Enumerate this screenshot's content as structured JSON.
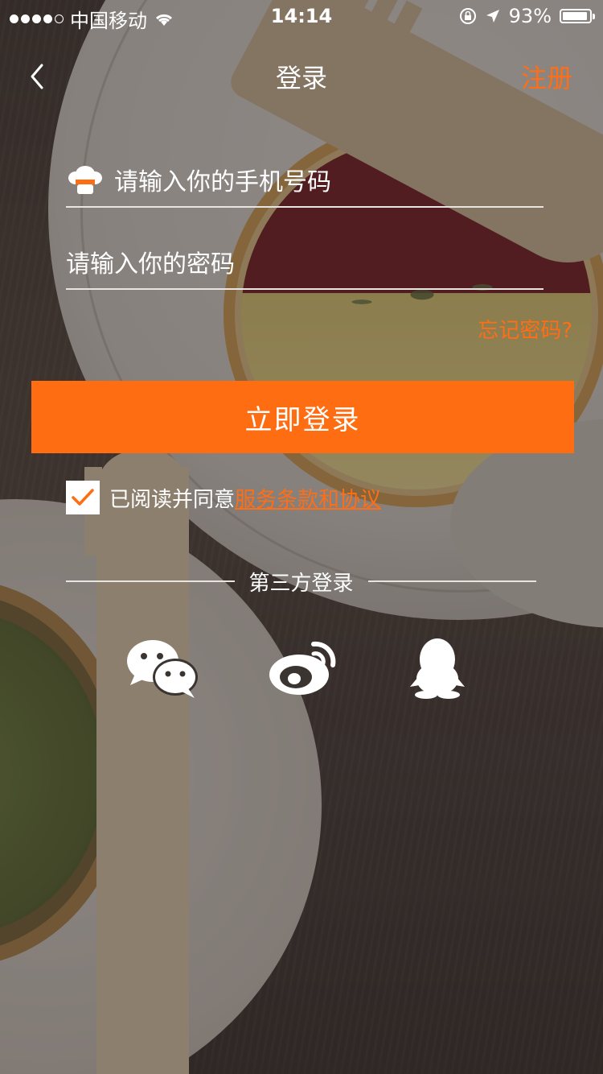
{
  "status_bar": {
    "carrier": "中国移动",
    "time": "14:14",
    "battery": "93%",
    "battery_level": 0.93,
    "signal_bars_filled": 4,
    "signal_bars_total": 5
  },
  "nav": {
    "title": "登录",
    "register": "注册",
    "back_icon": "chevron-left-icon"
  },
  "form": {
    "phone_placeholder": "请输入你的手机号码",
    "password_placeholder": "请输入你的密码",
    "forgot": "忘记密码?",
    "phone_icon": "chef-hat-icon"
  },
  "login_button": "立即登录",
  "agreement": {
    "checked": true,
    "text": "已阅读并同意",
    "link": "服务条款和协议"
  },
  "third_party": {
    "title": "第三方登录",
    "providers": [
      "wechat-icon",
      "weibo-icon",
      "qq-icon"
    ]
  },
  "colors": {
    "accent": "#ff6d12",
    "text": "#ffffff"
  }
}
